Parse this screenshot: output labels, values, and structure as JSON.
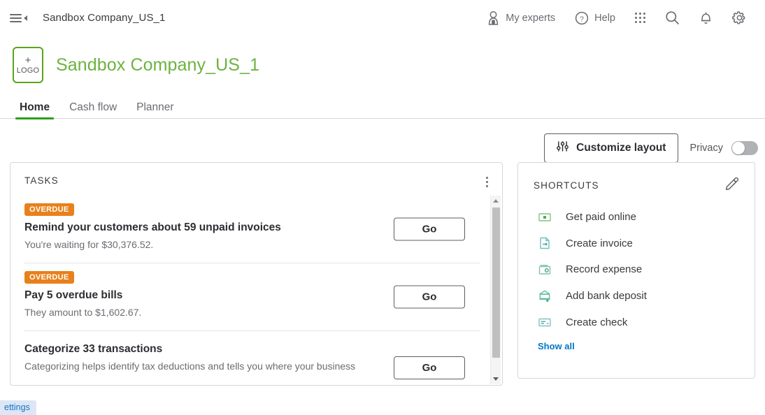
{
  "topbar": {
    "menu_icon": "hamburger-collapse-icon",
    "title": "Sandbox Company_US_1",
    "items": [
      {
        "label": "My experts",
        "icon": "expert-person-icon"
      },
      {
        "label": "Help",
        "icon": "help-circle-icon"
      }
    ],
    "icons": [
      {
        "name": "apps-grid-icon"
      },
      {
        "name": "search-icon"
      },
      {
        "name": "notification-bell-icon"
      },
      {
        "name": "settings-gear-icon"
      }
    ]
  },
  "company": {
    "logo_plus": "+",
    "logo_label": "LOGO",
    "name": "Sandbox Company_US_1"
  },
  "tabs": [
    {
      "label": "Home",
      "active": true
    },
    {
      "label": "Cash flow",
      "active": false
    },
    {
      "label": "Planner",
      "active": false
    }
  ],
  "actions": {
    "customize_label": "Customize layout",
    "customize_icon": "sliders-icon",
    "privacy_label": "Privacy",
    "privacy_on": false
  },
  "tasks": {
    "title": "TASKS",
    "menu_icon": "kebab-menu-icon",
    "items": [
      {
        "badge": "OVERDUE",
        "title": "Remind your customers about 59 unpaid invoices",
        "subtitle": "You're waiting for $30,376.52.",
        "button": "Go"
      },
      {
        "badge": "OVERDUE",
        "title": "Pay 5 overdue bills",
        "subtitle": "They amount to $1,602.67.",
        "button": "Go"
      },
      {
        "badge": "",
        "title": "Categorize 33 transactions",
        "subtitle": "Categorizing helps identify tax deductions and tells you where your business",
        "button": "Go"
      }
    ]
  },
  "shortcuts": {
    "title": "SHORTCUTS",
    "edit_icon": "pencil-edit-icon",
    "items": [
      {
        "label": "Get paid online",
        "icon": "money-bill-icon"
      },
      {
        "label": "Create invoice",
        "icon": "invoice-document-icon"
      },
      {
        "label": "Record expense",
        "icon": "receipt-wallet-icon"
      },
      {
        "label": "Add bank deposit",
        "icon": "bank-deposit-icon"
      },
      {
        "label": "Create check",
        "icon": "check-icon"
      }
    ],
    "show_all": "Show all"
  },
  "bottom_chip": {
    "text": "ettings"
  },
  "colors": {
    "brand_green": "#6cb33f",
    "tab_underline": "#2ca01c",
    "badge_orange": "#e8801b",
    "link_blue": "#0077c5",
    "shortcut_icon_green": "#8ec98e"
  }
}
